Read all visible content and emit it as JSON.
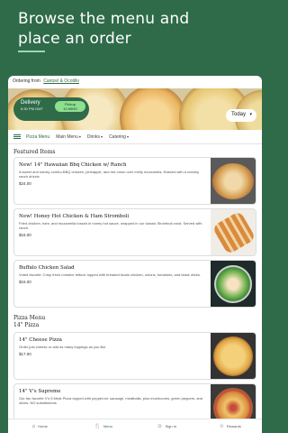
{
  "promo": {
    "line1": "Browse the menu and",
    "line2": "place an order"
  },
  "order_from": {
    "prefix": "Ordering from",
    "location": "Cantzel & Ocotillo"
  },
  "mode": {
    "delivery_label": "Delivery",
    "delivery_time": "6:30 PM GMT",
    "pickup_line1": "Pickup",
    "pickup_line2": "10 MINS"
  },
  "schedule": {
    "selected": "Today"
  },
  "categories": {
    "items": [
      {
        "label": "Pizza Menu",
        "active": true
      },
      {
        "label": "Main Menu"
      },
      {
        "label": "Drinks"
      },
      {
        "label": "Catering"
      }
    ]
  },
  "featured": {
    "title": "Featured Items",
    "items": [
      {
        "title": "New! 14\" Hawaiian Bbq Chicken w/ Ranch",
        "desc": "A sweet and smoky combo-BBQ chicken, pineapple, and red onion over melty mozzarella, finished with a creamy ranch drizzle.",
        "price": "$24.00"
      },
      {
        "title": "New! Honey Hot Chicken & Ham Stromboli",
        "desc": "Fried chicken, ham, and mozzarella tossed in honey hot sauce, wrapped in our classic Stromboli crust. Served with ranch.",
        "price": "$16.00"
      },
      {
        "title": "Buffalo Chicken Salad",
        "desc": "Voted favorite: Crisp fresh romaine lettuce topped with breaded buato chicken, onions, tomatoes, and black olives.",
        "price": "$16.00"
      }
    ]
  },
  "pizza_menu": {
    "title": "Pizza Menu",
    "subtitle": "14\" Pizza",
    "items": [
      {
        "title": "14\" Cheese Pizza",
        "desc": "Order just cheese or add as many toppings as you like",
        "price": "$17.00"
      },
      {
        "title": "14\" V's Supreme",
        "desc": "Our fan favorite V's 5 Meat Pizza topped with pepperoni, sausage, meatballs, plus mushrooms, green peppers, and olives. NO substitutions",
        "price": ""
      }
    ]
  },
  "bottom_nav": {
    "items": [
      {
        "label": "Home",
        "icon": "home-icon"
      },
      {
        "label": "Menu",
        "icon": "fork-knife-icon",
        "active": true
      },
      {
        "label": "Sign In",
        "icon": "user-icon"
      },
      {
        "label": "Rewards",
        "icon": "star-icon"
      }
    ]
  },
  "colors": {
    "brand": "#2f6b49",
    "pickup": "#8ee08f"
  }
}
